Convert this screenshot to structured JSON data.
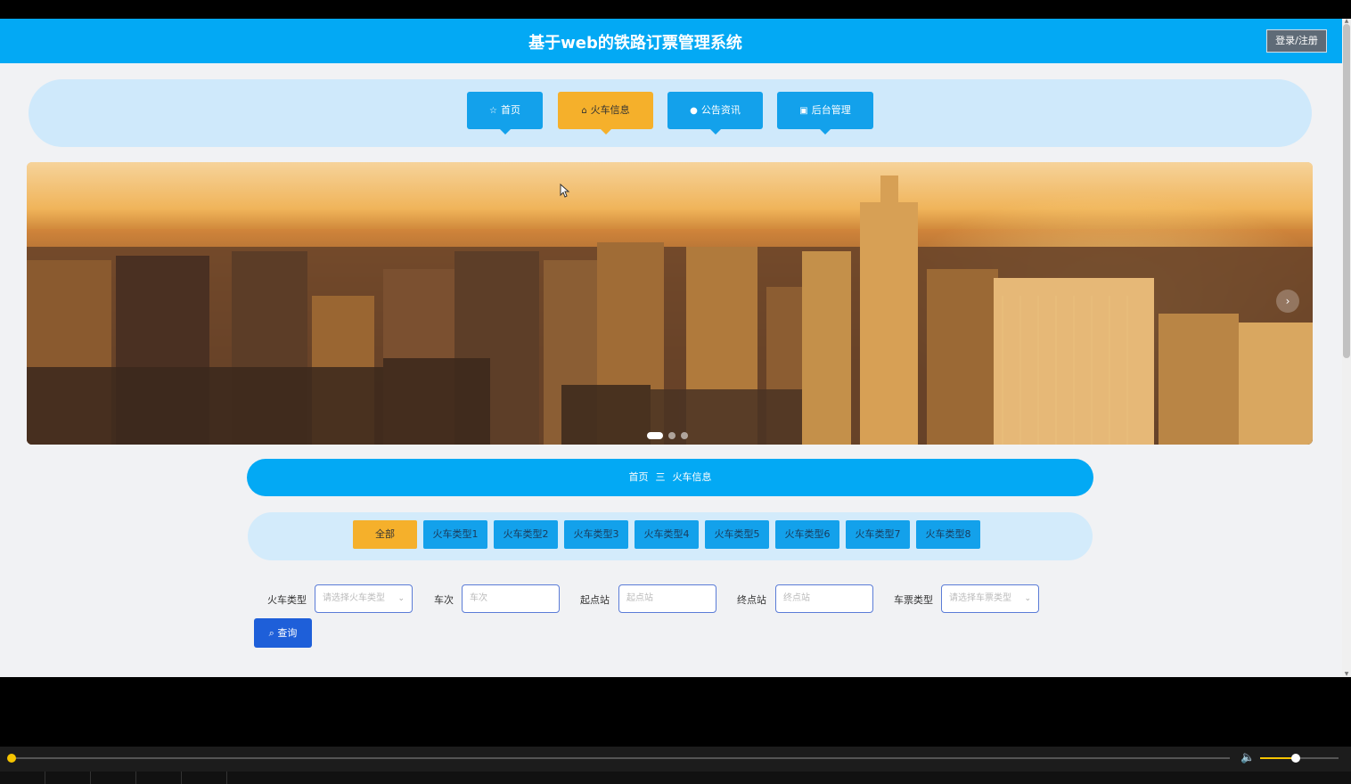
{
  "header": {
    "title": "基于web的铁路订票管理系统",
    "login_label": "登录/注册"
  },
  "nav": [
    {
      "label": "首页",
      "icon": "star-icon",
      "active": false
    },
    {
      "label": "火车信息",
      "icon": "bag-icon",
      "active": true
    },
    {
      "label": "公告资讯",
      "icon": "info-circle-icon",
      "active": false
    },
    {
      "label": "后台管理",
      "icon": "calendar-icon",
      "active": false
    }
  ],
  "banner": {
    "slides": 3,
    "active_slide": 1,
    "next_icon": "chevron-right-icon"
  },
  "breadcrumb": {
    "home": "首页",
    "separator": "三",
    "current": "火车信息"
  },
  "categories": [
    "全部",
    "火车类型1",
    "火车类型2",
    "火车类型3",
    "火车类型4",
    "火车类型5",
    "火车类型6",
    "火车类型7",
    "火车类型8"
  ],
  "active_category": "全部",
  "filters": {
    "train_type": {
      "label": "火车类型",
      "placeholder": "请选择火车类型"
    },
    "train_no": {
      "label": "车次",
      "placeholder": "车次"
    },
    "start": {
      "label": "起点站",
      "placeholder": "起点站"
    },
    "end": {
      "label": "终点站",
      "placeholder": "终点站"
    },
    "ticket_type": {
      "label": "车票类型",
      "placeholder": "请选择车票类型"
    },
    "search_label": "查询"
  },
  "player": {
    "progress": 0.0,
    "volume": 0.45
  },
  "colors": {
    "primary": "#03a9f4",
    "active": "#f5b02b",
    "search": "#1e5fd9"
  }
}
